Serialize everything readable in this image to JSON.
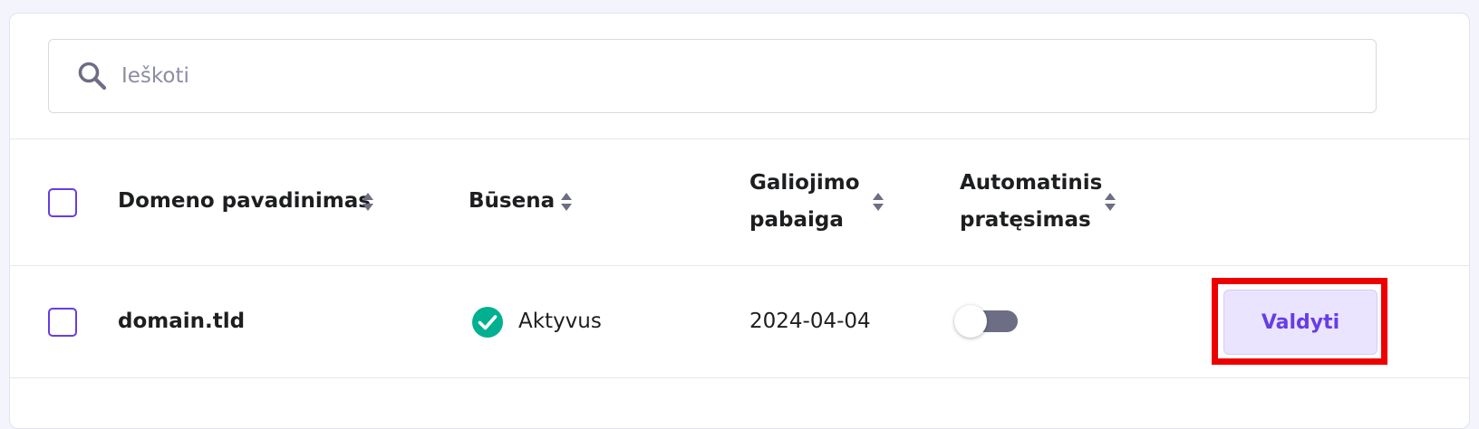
{
  "search": {
    "placeholder": "Ieškoti",
    "icon": "search-icon"
  },
  "table": {
    "columns": [
      {
        "line1": "Domeno pavadinimas",
        "line2": ""
      },
      {
        "line1": "Būsena",
        "line2": ""
      },
      {
        "line1": "Galiojimo",
        "line2": "pabaiga"
      },
      {
        "line1": "Automatinis",
        "line2": "pratęsimas"
      }
    ],
    "rows": [
      {
        "domain": "domain.tld",
        "status": "Aktyvus",
        "expiry": "2024-04-04",
        "auto_renew": false,
        "action_label": "Valdyti"
      }
    ]
  },
  "colors": {
    "accent": "#673de6",
    "status_active": "#00b090",
    "highlight": "#ee0000"
  }
}
